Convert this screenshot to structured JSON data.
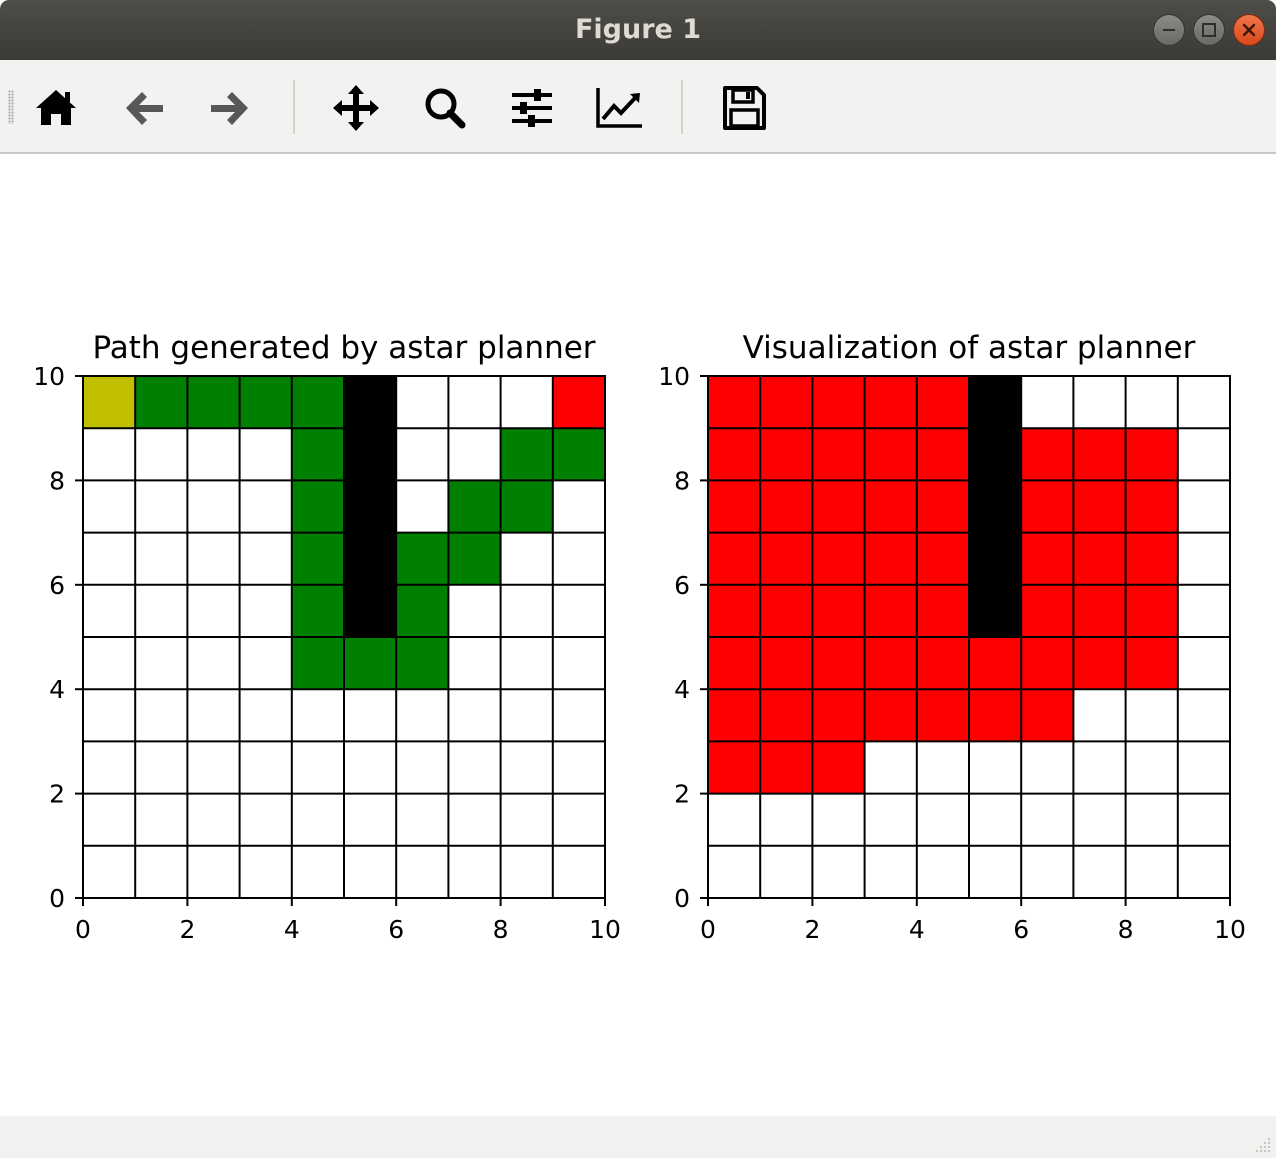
{
  "window": {
    "title": "Figure 1",
    "controls": [
      "minimize-icon",
      "maximize-icon",
      "close-icon"
    ]
  },
  "toolbar": {
    "buttons": [
      {
        "name": "home",
        "icon": "home-icon"
      },
      {
        "name": "back",
        "icon": "arrow-left-icon"
      },
      {
        "name": "forward",
        "icon": "arrow-right-icon"
      },
      {
        "name": "pan",
        "icon": "move-arrows-icon"
      },
      {
        "name": "zoom",
        "icon": "magnifier-icon"
      },
      {
        "name": "subplots",
        "icon": "sliders-icon"
      },
      {
        "name": "edit-axes",
        "icon": "line-chart-icon"
      },
      {
        "name": "save",
        "icon": "floppy-disk-icon"
      }
    ]
  },
  "colors": {
    "start": "#bfbf00",
    "goal": "#ff0000",
    "path": "#008000",
    "obstacle": "#000000",
    "visited": "#ff0000",
    "free": "#ffffff"
  },
  "chart_data": [
    {
      "type": "heatmap",
      "title": "Path generated by astar planner",
      "xlim": [
        0,
        10
      ],
      "ylim": [
        0,
        10
      ],
      "xticks": [
        "0",
        "2",
        "4",
        "6",
        "8",
        "10"
      ],
      "yticks": [
        "0",
        "2",
        "4",
        "6",
        "8",
        "10"
      ],
      "grid": true,
      "cells": {
        "start": [
          [
            0,
            9
          ]
        ],
        "goal": [
          [
            9,
            9
          ]
        ],
        "obstacle": [
          [
            5,
            5
          ],
          [
            5,
            6
          ],
          [
            5,
            7
          ],
          [
            5,
            8
          ],
          [
            5,
            9
          ]
        ],
        "path": [
          [
            1,
            9
          ],
          [
            2,
            9
          ],
          [
            3,
            9
          ],
          [
            4,
            9
          ],
          [
            4,
            8
          ],
          [
            4,
            7
          ],
          [
            4,
            6
          ],
          [
            4,
            5
          ],
          [
            4,
            4
          ],
          [
            5,
            4
          ],
          [
            6,
            4
          ],
          [
            6,
            5
          ],
          [
            6,
            6
          ],
          [
            7,
            6
          ],
          [
            7,
            7
          ],
          [
            8,
            7
          ],
          [
            8,
            8
          ],
          [
            9,
            8
          ]
        ]
      }
    },
    {
      "type": "heatmap",
      "title": "Visualization of astar planner",
      "xlim": [
        0,
        10
      ],
      "ylim": [
        0,
        10
      ],
      "xticks": [
        "0",
        "2",
        "4",
        "6",
        "8",
        "10"
      ],
      "yticks": [
        "0",
        "2",
        "4",
        "6",
        "8",
        "10"
      ],
      "grid": true,
      "cells": {
        "obstacle": [
          [
            5,
            5
          ],
          [
            5,
            6
          ],
          [
            5,
            7
          ],
          [
            5,
            8
          ],
          [
            5,
            9
          ]
        ],
        "visited": [
          [
            0,
            9
          ],
          [
            1,
            9
          ],
          [
            2,
            9
          ],
          [
            3,
            9
          ],
          [
            4,
            9
          ],
          [
            0,
            8
          ],
          [
            1,
            8
          ],
          [
            2,
            8
          ],
          [
            3,
            8
          ],
          [
            4,
            8
          ],
          [
            6,
            8
          ],
          [
            7,
            8
          ],
          [
            8,
            8
          ],
          [
            0,
            7
          ],
          [
            1,
            7
          ],
          [
            2,
            7
          ],
          [
            3,
            7
          ],
          [
            4,
            7
          ],
          [
            6,
            7
          ],
          [
            7,
            7
          ],
          [
            8,
            7
          ],
          [
            0,
            6
          ],
          [
            1,
            6
          ],
          [
            2,
            6
          ],
          [
            3,
            6
          ],
          [
            4,
            6
          ],
          [
            6,
            6
          ],
          [
            7,
            6
          ],
          [
            8,
            6
          ],
          [
            0,
            5
          ],
          [
            1,
            5
          ],
          [
            2,
            5
          ],
          [
            3,
            5
          ],
          [
            4,
            5
          ],
          [
            6,
            5
          ],
          [
            7,
            5
          ],
          [
            8,
            5
          ],
          [
            0,
            4
          ],
          [
            1,
            4
          ],
          [
            2,
            4
          ],
          [
            3,
            4
          ],
          [
            4,
            4
          ],
          [
            5,
            4
          ],
          [
            6,
            4
          ],
          [
            7,
            4
          ],
          [
            8,
            4
          ],
          [
            0,
            3
          ],
          [
            1,
            3
          ],
          [
            2,
            3
          ],
          [
            3,
            3
          ],
          [
            4,
            3
          ],
          [
            5,
            3
          ],
          [
            6,
            3
          ],
          [
            0,
            2
          ],
          [
            1,
            2
          ],
          [
            2,
            2
          ]
        ]
      }
    }
  ]
}
